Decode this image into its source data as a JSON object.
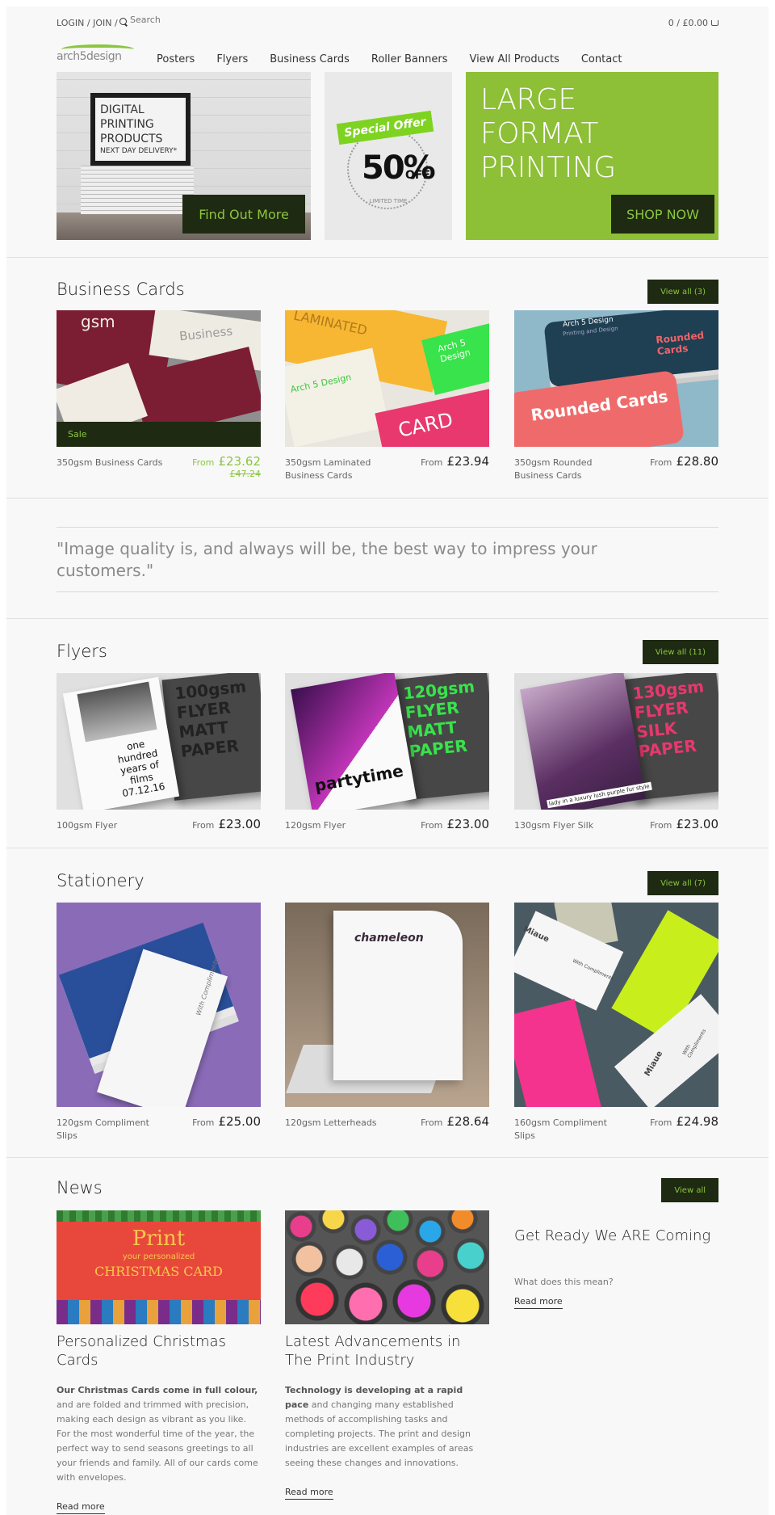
{
  "topbar": {
    "login": "LOGIN / JOIN /",
    "search_placeholder": "Search",
    "cart": "0 / £0.00"
  },
  "logo": {
    "text": "arch5design"
  },
  "nav": [
    "Posters",
    "Flyers",
    "Business Cards",
    "Roller Banners",
    "View All Products",
    "Contact"
  ],
  "hero": {
    "banner1": {
      "frame_lines": [
        "DIGITAL",
        "PRINTING",
        "PRODUCTS"
      ],
      "frame_small": "NEXT DAY DELIVERY*",
      "button": "Find Out More"
    },
    "banner2": {
      "ribbon": "Special Offer",
      "percent": "50%",
      "off": "OFF",
      "caption": "LIMITED TIME"
    },
    "banner3": {
      "lines": [
        "LARGE",
        "FORMAT",
        "PRINTING"
      ],
      "button": "SHOP NOW"
    }
  },
  "colors": {
    "accent": "#8cc63f",
    "dark": "#1e2a12",
    "hero_green": "#8dbf37"
  },
  "business_cards": {
    "title": "Business Cards",
    "view_all": "View all (3)",
    "items": [
      {
        "name": "350gsm Business Cards",
        "from": "From",
        "price": "£23.62",
        "old_price": "£47.24",
        "badge": "Sale",
        "img_text": [
          "gsm",
          "Business"
        ]
      },
      {
        "name": "350gsm Laminated Business Cards",
        "from": "From",
        "price": "£23.94",
        "img_text": [
          "LAMINATED",
          "Arch 5 Design",
          "Arch 5 Design",
          "CARD"
        ]
      },
      {
        "name": "350gsm Rounded Business Cards",
        "from": "From",
        "price": "£28.80",
        "img_text": [
          "Arch 5 Design",
          "Printing and Design",
          "Rounded Cards",
          "Rounded Cards"
        ]
      }
    ]
  },
  "quote": "\"Image quality is, and always will be, the best way to impress your customers.\"",
  "flyers": {
    "title": "Flyers",
    "view_all": "View all (11)",
    "items": [
      {
        "name": "100gsm Flyer",
        "from": "From",
        "price": "£23.00",
        "img_big": "100gsm FLYER MATT PAPER",
        "img_small": "one hundred years of films 07.12.16"
      },
      {
        "name": "120gsm Flyer",
        "from": "From",
        "price": "£23.00",
        "img_big": "120gsm FLYER MATT PAPER",
        "img_small": "partytime"
      },
      {
        "name": "130gsm Flyer Silk",
        "from": "From",
        "price": "£23.00",
        "img_big": "130gsm FLYER SILK PAPER",
        "img_small": "lady in a luxury lush purple fur style"
      }
    ]
  },
  "stationery": {
    "title": "Stationery",
    "view_all": "View all (7)",
    "items": [
      {
        "name": "120gsm Compliment Slips",
        "from": "From",
        "price": "£25.00",
        "img_text": "With Compliments"
      },
      {
        "name": "120gsm Letterheads",
        "from": "From",
        "price": "£28.64",
        "img_text": "chameleon"
      },
      {
        "name": "160gsm Compliment Slips",
        "from": "From",
        "price": "£24.98",
        "img_text": [
          "Miaue",
          "With Compliments",
          "Miaue",
          "With Compliments"
        ]
      }
    ]
  },
  "news": {
    "title": "News",
    "view_all": "View all",
    "items": [
      {
        "title": "Personalized Christmas Cards",
        "lead": "Our Christmas Cards come in full colour,",
        "body": " and are folded and trimmed with precision, making each design as vibrant as you like. For the most wonderful time of the year, the perfect way to send seasons greetings to all your friends and family. All of our cards come with envelopes.",
        "read_more": "Read more",
        "img_lines": [
          "Print",
          "your personalized",
          "CHRISTMAS CARD"
        ]
      },
      {
        "title": "Latest Advancements in The Print Industry",
        "lead": "Technology is developing at a rapid pace",
        "body": " and changing many established methods of accomplishing tasks and completing projects. The print and design industries are excellent examples of areas seeing these changes and innovations.",
        "read_more": "Read more"
      },
      {
        "title": "Get Ready We ARE Coming",
        "body": "What does this mean?",
        "read_more": "Read more"
      }
    ]
  }
}
